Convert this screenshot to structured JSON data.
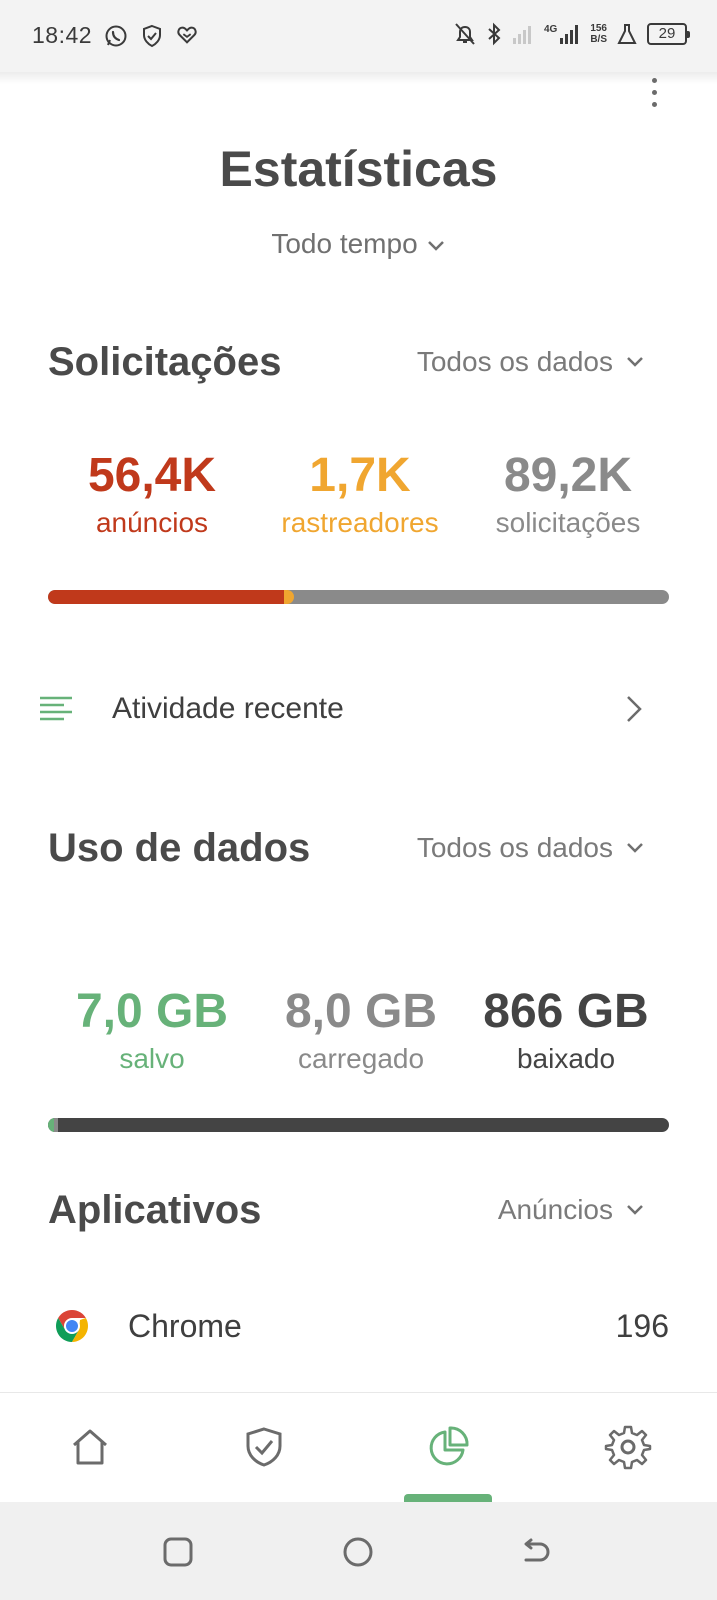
{
  "status_bar": {
    "time": "18:42",
    "left_icons": [
      "whatsapp-icon",
      "shield-check-icon",
      "heart-shield-icon"
    ],
    "right_icons": [
      "bell-off-icon",
      "bluetooth-icon",
      "signal-weak-icon",
      "signal-4g-icon"
    ],
    "network_type": "4G",
    "speed_value": "156",
    "speed_unit": "B/S",
    "battery": "29"
  },
  "page": {
    "title": "Estatísticas",
    "period": "Todo tempo"
  },
  "requests": {
    "title": "Solicitações",
    "filter": "Todos os dados",
    "ads_value": "56,4K",
    "ads_label": "anúncios",
    "trackers_value": "1,7K",
    "trackers_label": "rastreadores",
    "total_value": "89,2K",
    "total_label": "solicitações",
    "colors": {
      "ads": "#c0391b",
      "trackers": "#f0a630",
      "total": "#8a8a8a"
    }
  },
  "activity": {
    "label": "Atividade recente"
  },
  "data_usage": {
    "title": "Uso de dados",
    "filter": "Todos os dados",
    "saved_value": "7,0 GB",
    "saved_label": "salvo",
    "uploaded_value": "8,0 GB",
    "uploaded_label": "carregado",
    "downloaded_value": "866 GB",
    "downloaded_label": "baixado",
    "colors": {
      "saved": "#67b279",
      "uploaded": "#8a8a8a",
      "downloaded": "#444444"
    }
  },
  "apps": {
    "title": "Aplicativos",
    "filter": "Anúncios",
    "items": [
      {
        "name": "Chrome",
        "count": "196",
        "icon": "chrome-icon"
      }
    ]
  },
  "bottom_nav": {
    "items": [
      "home-icon",
      "shield-icon",
      "statistics-icon",
      "settings-icon"
    ],
    "active": "statistics-icon",
    "accent": "#67b279"
  },
  "system_nav": [
    "recents-icon",
    "home-circle-icon",
    "back-icon"
  ]
}
